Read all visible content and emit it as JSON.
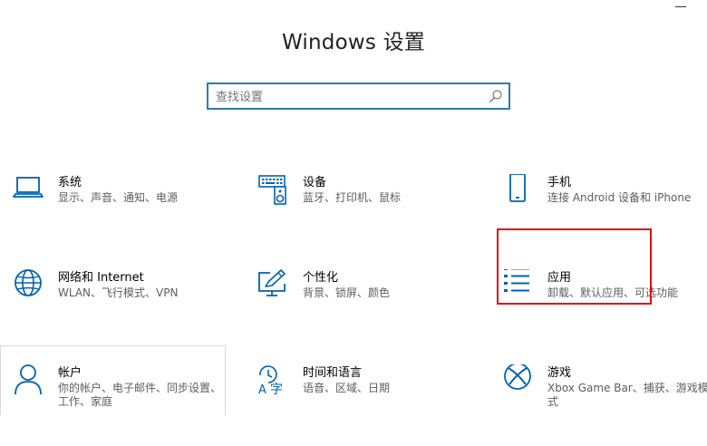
{
  "window": {
    "title": "Windows 设置"
  },
  "search": {
    "placeholder": "查找设置"
  },
  "tiles": [
    {
      "id": "system",
      "name": "系统",
      "desc": "显示、声音、通知、电源",
      "icon": "laptop-icon"
    },
    {
      "id": "devices",
      "name": "设备",
      "desc": "蓝牙、打印机、鼠标",
      "icon": "keyboard-speaker-icon"
    },
    {
      "id": "phone",
      "name": "手机",
      "desc": "连接 Android 设备和 iPhone",
      "icon": "phone-icon"
    },
    {
      "id": "network",
      "name": "网络和 Internet",
      "desc": "WLAN、飞行模式、VPN",
      "icon": "globe-icon"
    },
    {
      "id": "personalization",
      "name": "个性化",
      "desc": "背景、锁屏、颜色",
      "icon": "pen-monitor-icon"
    },
    {
      "id": "apps",
      "name": "应用",
      "desc": "卸载、默认应用、可选功能",
      "icon": "app-list-icon"
    },
    {
      "id": "accounts",
      "name": "帐户",
      "desc": "你的帐户、电子邮件、同步设置、工作、家庭",
      "icon": "person-icon"
    },
    {
      "id": "time-language",
      "name": "时间和语言",
      "desc": "语音、区域、日期",
      "icon": "language-icon"
    },
    {
      "id": "gaming",
      "name": "游戏",
      "desc": "Xbox Game Bar、捕获、游戏模式",
      "icon": "xbox-icon"
    }
  ],
  "colors": {
    "accent": "#0063b1",
    "search_border": "#2b7bb5",
    "highlight": "#e00d0d",
    "tile_border": "#d9d9d9"
  }
}
